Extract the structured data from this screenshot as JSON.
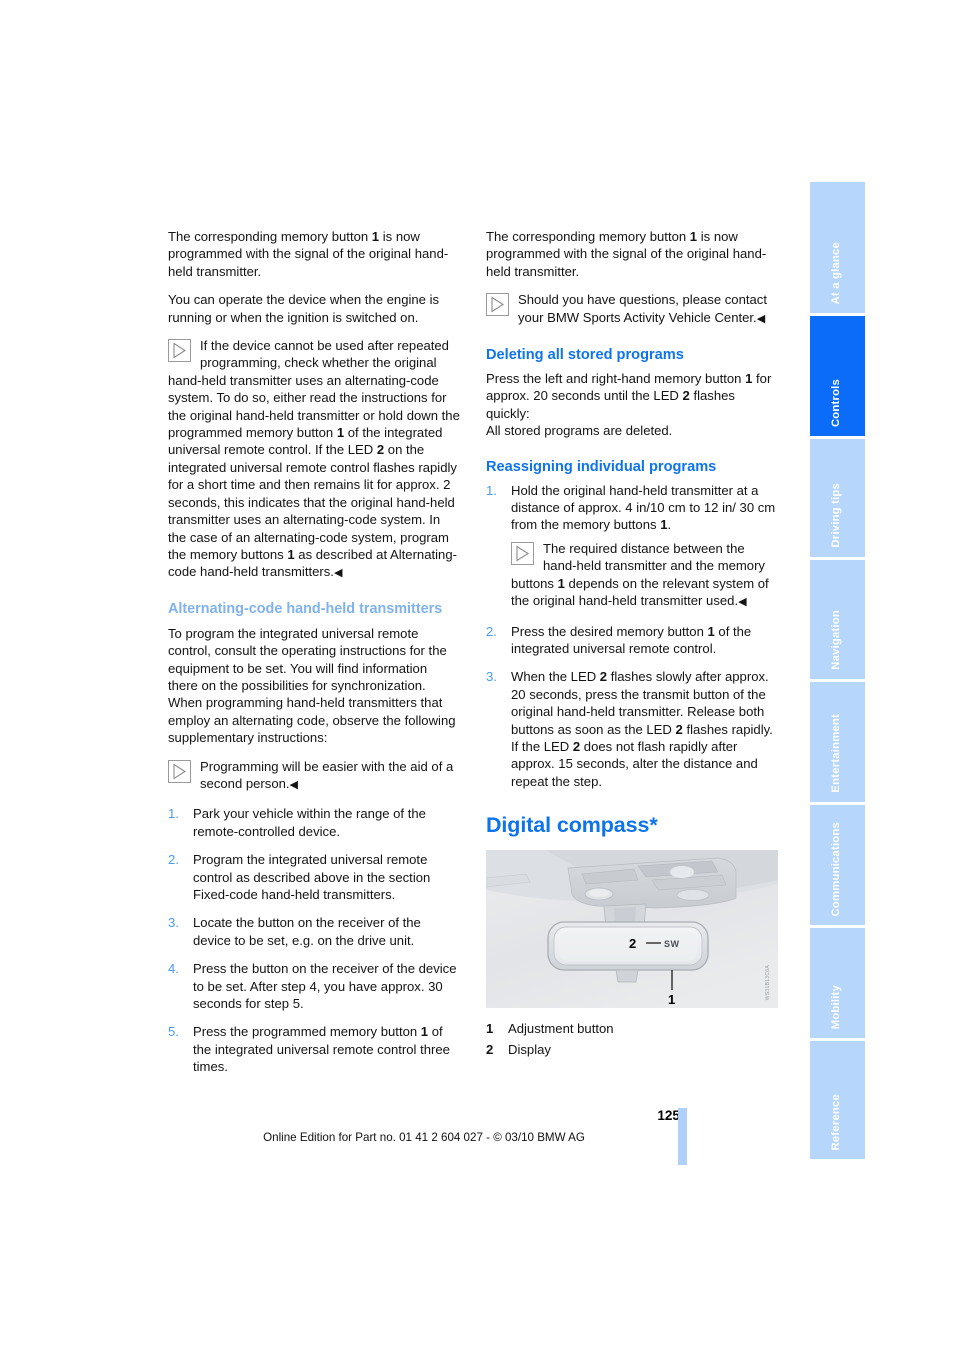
{
  "document": {
    "page_number": "125",
    "footer_note": "Online Edition for Part no. 01 41 2 604 027 - © 03/10 BMW AG"
  },
  "sidebar": {
    "tabs": [
      {
        "label": "At a glance",
        "active": false
      },
      {
        "label": "Controls",
        "active": true
      },
      {
        "label": "Driving tips",
        "active": false
      },
      {
        "label": "Navigation",
        "active": false
      },
      {
        "label": "Entertainment",
        "active": false
      },
      {
        "label": "Communications",
        "active": false
      },
      {
        "label": "Mobility",
        "active": false
      },
      {
        "label": "Reference",
        "active": false
      }
    ],
    "active_color": "#0B6CFA",
    "inactive_color": "#B6D6FB"
  },
  "left_column": {
    "para_1": "The corresponding memory button 1 is now programmed with the signal of the original hand-held transmitter.",
    "para_1_parts": {
      "a": "The corresponding memory button ",
      "bold": "1",
      "b": " is now programmed with the signal of the original hand-held transmitter."
    },
    "para_2": "You can operate the device when the engine is running or when the ignition is switched on.",
    "note_1": {
      "text_a": "If the device cannot be used after repeated programming, check whether the original hand-held transmitter uses an alternating-code system. To do so, either read the instructions for the original hand-held transmitter or hold down the programmed memory button ",
      "bold_1": "1",
      "text_b": " of the integrated universal remote control. If the LED ",
      "bold_2": "2",
      "text_c": " on the integrated universal remote control flashes rapidly for a short time and then remains lit for approx. 2 seconds, this indicates that the original hand-held transmitter uses an alternating-code system. In the case of an alternating-code system, program the memory buttons ",
      "bold_3": "1",
      "text_d": " as described at Alternating-code hand-held transmitters.",
      "endmark": "◀"
    },
    "heading_subsection": "Alternating-code hand-held transmitters",
    "para_3": "To program the integrated universal remote control, consult the operating instructions for the equipment to be set. You will find information there on the possibilities for synchronization.",
    "para_4": "When programming hand-held transmitters that employ an alternating code, observe the following supplementary instructions:",
    "note_2": {
      "text": "Programming will be easier with the aid of a second person.",
      "endmark": "◀"
    },
    "steps": [
      {
        "text": "Park your vehicle within the range of the remote-controlled device."
      },
      {
        "text": "Program the integrated universal remote control as described above in the section Fixed-code hand-held transmitters."
      },
      {
        "text": "Locate the button on the receiver of the device to be set, e.g. on the drive unit."
      },
      {
        "text": "Press the button on the receiver of the device to be set. After step 4, you have approx. 30 seconds for step 5."
      },
      {
        "text_a": "Press the programmed memory button ",
        "bold": "1",
        "text_b": " of the integrated universal remote control three times."
      }
    ]
  },
  "right_column": {
    "para_1_parts": {
      "a": "The corresponding memory button ",
      "bold": "1",
      "b": " is now programmed with the signal of the original hand-held transmitter."
    },
    "note_1": {
      "text": "Should you have questions, please contact your BMW Sports Activity Vehicle Center.",
      "endmark": "◀"
    },
    "heading_delete": "Deleting all stored programs",
    "delete_para": {
      "a": "Press the left and right-hand memory button ",
      "bold_1": "1",
      "b": " for approx. 20 seconds until the LED ",
      "bold_2": "2",
      "c": " flashes quickly:"
    },
    "delete_result": "All stored programs are deleted.",
    "heading_reassign": "Reassigning individual programs",
    "steps": [
      {
        "text_a": "Hold the original hand-held transmitter at a distance of approx. 4 in/10 cm to 12 in/ 30 cm from the memory buttons ",
        "bold": "1",
        "text_b": ".",
        "note": {
          "text_a": "The required distance between the hand-held transmitter and the memory buttons ",
          "bold": "1",
          "text_b": " depends on the relevant system of the original hand-held transmitter used.",
          "endmark": "◀"
        }
      },
      {
        "text_a": "Press the desired memory button ",
        "bold": "1",
        "text_b": " of the integrated universal remote control."
      },
      {
        "text_a": "When the LED ",
        "bold_1": "2",
        "text_b": " flashes slowly after approx. 20 seconds, press the transmit button of the original hand-held transmitter. Release both buttons as soon as the LED ",
        "bold_2": "2",
        "text_c": " flashes rapidly. If the LED ",
        "bold_3": "2",
        "text_d": " does not flash rapidly after approx. 15 seconds, alter the distance and repeat the step."
      }
    ],
    "heading_compass": "Digital compass*",
    "figure": {
      "alt": "Rearview mirror with digital compass display",
      "display_text": "SW",
      "callout_1": "1",
      "callout_2": "2",
      "code": "WS31B13C6A"
    },
    "legend": [
      {
        "num": "1",
        "label": "Adjustment button"
      },
      {
        "num": "2",
        "label": "Display"
      }
    ]
  }
}
